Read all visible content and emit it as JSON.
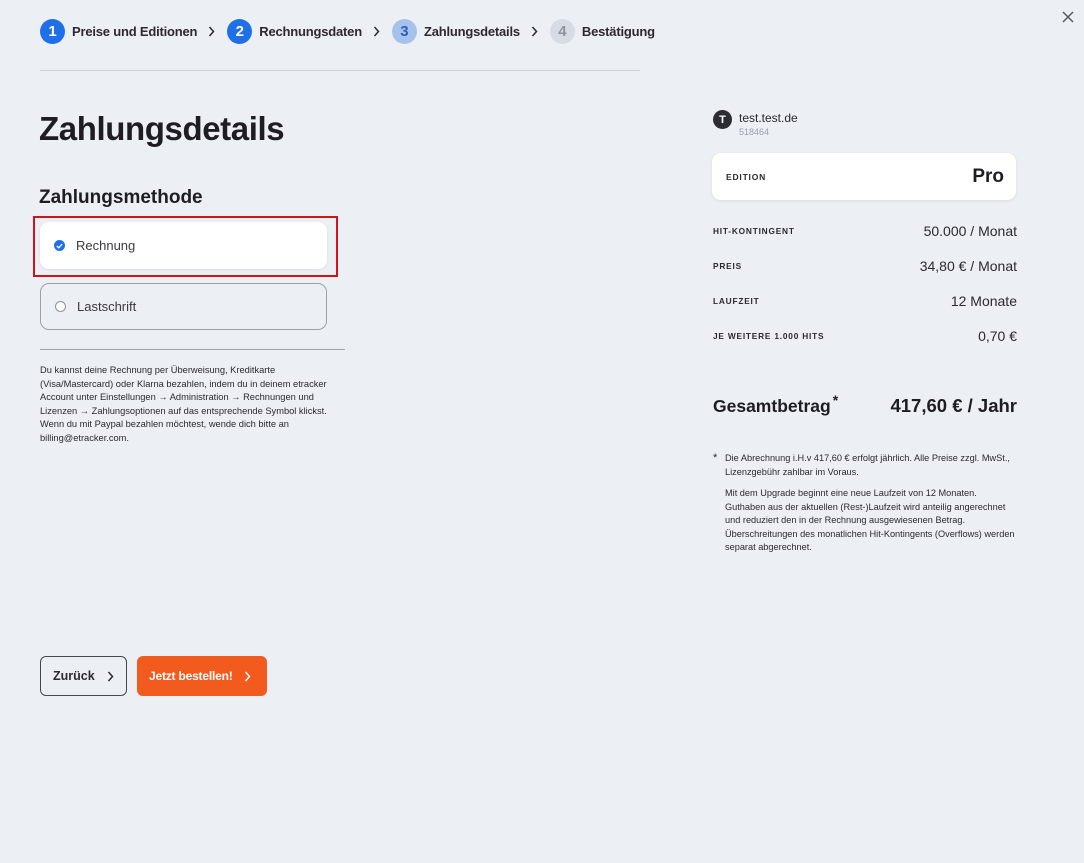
{
  "stepper": {
    "steps": [
      {
        "number": "1",
        "label": "Preise und Editionen"
      },
      {
        "number": "2",
        "label": "Rechnungsdaten"
      },
      {
        "number": "3",
        "label": "Zahlungsdetails"
      },
      {
        "number": "4",
        "label": "Bestätigung"
      }
    ],
    "colors": {
      "done": "#1f6fe8",
      "current": "#a7c2ea",
      "upcoming": "#d7dbe2"
    }
  },
  "page": {
    "title": "Zahlungsdetails",
    "section_title": "Zahlungsmethode"
  },
  "payment_methods": [
    {
      "label": "Rechnung",
      "selected": true
    },
    {
      "label": "Lastschrift",
      "selected": false
    }
  ],
  "info_text": "Du kannst deine Rechnung per Überweisung, Kreditkarte (Visa/Mastercard) oder Klarna bezahlen, indem du in deinem etracker Account unter Einstellungen → Administration → Rechnungen und Lizenzen → Zahlungsoptionen auf das entsprechende Symbol klickst. Wenn du mit Paypal bezahlen möchtest, wende dich bitte an billing@etracker.com.",
  "buttons": {
    "back_label": "Zurück",
    "order_label": "Jetzt bestellen!",
    "order_color": "#f35a1e"
  },
  "account": {
    "avatar_letter": "T",
    "name": "test.test.de",
    "id": "518464"
  },
  "summary": {
    "edition_label": "EDITION",
    "edition_value": "Pro",
    "rows": [
      {
        "label": "HIT-KONTINGENT",
        "value": "50.000 / Monat"
      },
      {
        "label": "PREIS",
        "value": "34,80 € / Monat"
      },
      {
        "label": "LAUFZEIT",
        "value": "12 Monate"
      },
      {
        "label": "JE WEITERE 1.000 HITS",
        "value": "0,70 €"
      }
    ],
    "total_label": "Gesamtbetrag",
    "total_marker": "*",
    "total_value": "417,60 € / Jahr"
  },
  "footnote": {
    "marker": "*",
    "line1": "Die Abrechnung i.H.v 417,60 € erfolgt jährlich. Alle Preise zzgl. MwSt., Lizenzgebühr zahlbar im Voraus.",
    "line2": "Mit dem Upgrade beginnt eine neue Laufzeit von 12 Monaten. Guthaben aus der aktuellen (Rest-)Laufzeit wird anteilig angerechnet und reduziert den in der Rechnung ausgewiesenen Betrag. Überschreitungen des monatlichen Hit-Kontingents (Overflows) werden separat abgerechnet."
  }
}
